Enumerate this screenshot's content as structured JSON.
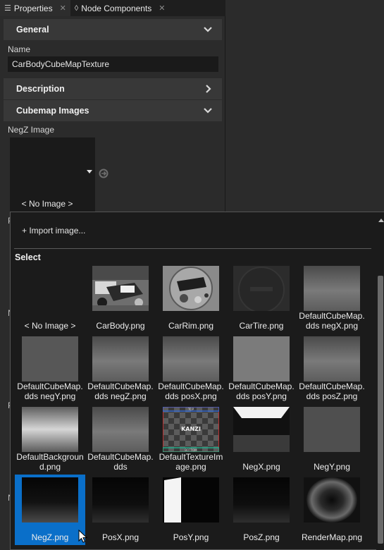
{
  "tabs": [
    {
      "label": "Properties",
      "active": true
    },
    {
      "label": "Node Components",
      "active": false
    }
  ],
  "sections": {
    "general": "General",
    "description": "Description",
    "cubemap_images": "Cubemap Images"
  },
  "name_label": "Name",
  "name_value": "CarBodyCubeMapTexture",
  "negz_label": "NegZ Image",
  "current_image": "< No Image >",
  "left_edge_chars": [
    "P",
    "N",
    "P",
    "N"
  ],
  "dropdown": {
    "import": "+ Import image...",
    "select_header": "Select",
    "items": [
      {
        "label": "< No Image >",
        "kind": "none"
      },
      {
        "label": "CarBody.png",
        "kind": "carbody"
      },
      {
        "label": "CarRim.png",
        "kind": "carrim"
      },
      {
        "label": "CarTire.png",
        "kind": "cartire"
      },
      {
        "label": "DefaultCubeMap.\ndds negX.png",
        "kind": "grad"
      },
      {
        "label": "DefaultCubeMap.\ndds negY.png",
        "kind": "flatdark"
      },
      {
        "label": "DefaultCubeMap.\ndds negZ.png",
        "kind": "grad"
      },
      {
        "label": "DefaultCubeMap.\ndds posX.png",
        "kind": "grad"
      },
      {
        "label": "DefaultCubeMap.\ndds posY.png",
        "kind": "flatlight"
      },
      {
        "label": "DefaultCubeMap.\ndds posZ.png",
        "kind": "grad"
      },
      {
        "label": "DefaultBackgroun\nd.png",
        "kind": "bg"
      },
      {
        "label": "DefaultCubeMap.\ndds",
        "kind": "grad"
      },
      {
        "label": "DefaultTextureIm\nage.png",
        "kind": "kanzi"
      },
      {
        "label": "NegX.png",
        "kind": "negx"
      },
      {
        "label": "NegY.png",
        "kind": "negy"
      },
      {
        "label": "NegZ.png",
        "kind": "floor",
        "selected": true
      },
      {
        "label": "PosX.png",
        "kind": "floordark"
      },
      {
        "label": "PosY.png",
        "kind": "posy"
      },
      {
        "label": "PosZ.png",
        "kind": "floordark"
      },
      {
        "label": "RenderMap.png",
        "kind": "rendermap"
      }
    ]
  },
  "kanzi_texture_text": {
    "top": "TOP",
    "center": "KANZI",
    "bottom": "BOTTOM"
  }
}
